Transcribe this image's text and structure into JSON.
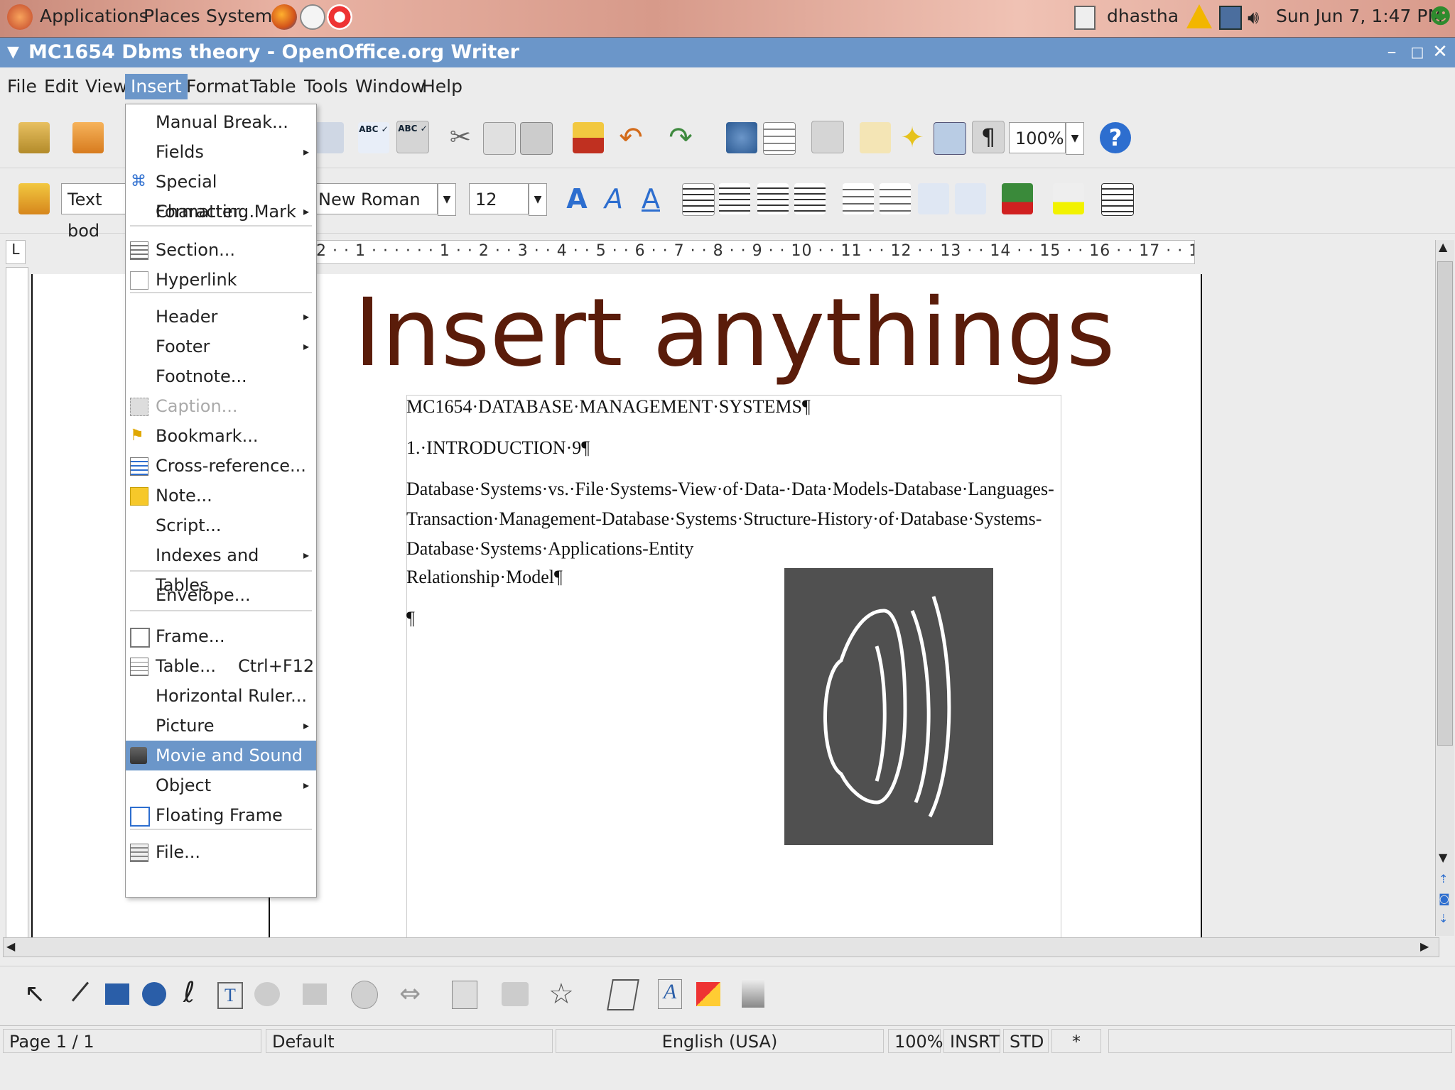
{
  "panel": {
    "applications": "Applications",
    "places": "Places",
    "system": "System",
    "user": "dhastha",
    "clock": "Sun Jun  7,  1:47 PM"
  },
  "window": {
    "title": "MC1654 Dbms theory - OpenOffice.org Writer",
    "minimize": "–",
    "maximize": "□",
    "close": "✕"
  },
  "menubar": [
    "File",
    "Edit",
    "View",
    "Insert",
    "Format",
    "Table",
    "Tools",
    "Window",
    "Help"
  ],
  "toolbar": {
    "zoom": "100%"
  },
  "formatbar": {
    "style": "Text bod",
    "font": "New Roman",
    "size": "12"
  },
  "ruler": {
    "ticks": "2 · · 1 · · · · · · 1 · · 2 · · 3 · · 4 · · 5 · · 6 · · 7 · · 8 · · 9 · · 10 · · 11 · · 12 · · 13 · · 14 · · 15 · · 16 · · 17 · · 18"
  },
  "document": {
    "heading": "Insert anythings",
    "line1": "MC1654·DATABASE·MANAGEMENT·SYSTEMS¶",
    "line2": "1.·INTRODUCTION·9¶",
    "line3": "Database·Systems·vs.·File·Systems-View·of·Data-·Data·Models-Database·Languages-",
    "line4": "Transaction·Management-Database·Systems·Structure-History·of·Database·Systems-",
    "line5": "Database·Systems·Applications-Entity",
    "line6": "Relationship·Model¶",
    "line7": "¶"
  },
  "insert_menu": [
    {
      "label": "Manual Break...",
      "icon": "none"
    },
    {
      "label": "Fields",
      "submenu": true,
      "icon": "none"
    },
    {
      "label": "Special Character...",
      "icon": "special-char-icon"
    },
    {
      "label": "Formatting Mark",
      "submenu": true,
      "icon": "none"
    },
    {
      "label": "Section...",
      "icon": "section-icon"
    },
    {
      "label": "Hyperlink",
      "icon": "hyperlink-icon"
    },
    {
      "label": "Header",
      "submenu": true,
      "icon": "none"
    },
    {
      "label": "Footer",
      "submenu": true,
      "icon": "none"
    },
    {
      "label": "Footnote...",
      "icon": "none"
    },
    {
      "label": "Caption...",
      "disabled": true,
      "icon": "caption-icon"
    },
    {
      "label": "Bookmark...",
      "icon": "bookmark-icon"
    },
    {
      "label": "Cross-reference...",
      "icon": "cross-reference-icon"
    },
    {
      "label": "Note...",
      "icon": "note-icon"
    },
    {
      "label": "Script...",
      "icon": "none"
    },
    {
      "label": "Indexes and Tables",
      "submenu": true,
      "icon": "none"
    },
    {
      "label": "Envelope...",
      "icon": "none"
    },
    {
      "label": "Frame...",
      "icon": "frame-icon"
    },
    {
      "label": "Table...",
      "shortcut": "Ctrl+F12",
      "icon": "table-icon"
    },
    {
      "label": "Horizontal Ruler...",
      "icon": "none"
    },
    {
      "label": "Picture",
      "submenu": true,
      "icon": "none"
    },
    {
      "label": "Movie and Sound",
      "highlighted": true,
      "icon": "movie-sound-icon"
    },
    {
      "label": "Object",
      "submenu": true,
      "icon": "none"
    },
    {
      "label": "Floating Frame",
      "icon": "floating-frame-icon"
    },
    {
      "label": "File...",
      "icon": "file-icon"
    }
  ],
  "statusbar": {
    "page": "Page 1 / 1",
    "style": "Default",
    "language": "English (USA)",
    "zoom": "100%",
    "mode": "INSRT",
    "selection": "STD",
    "modified": "*"
  }
}
